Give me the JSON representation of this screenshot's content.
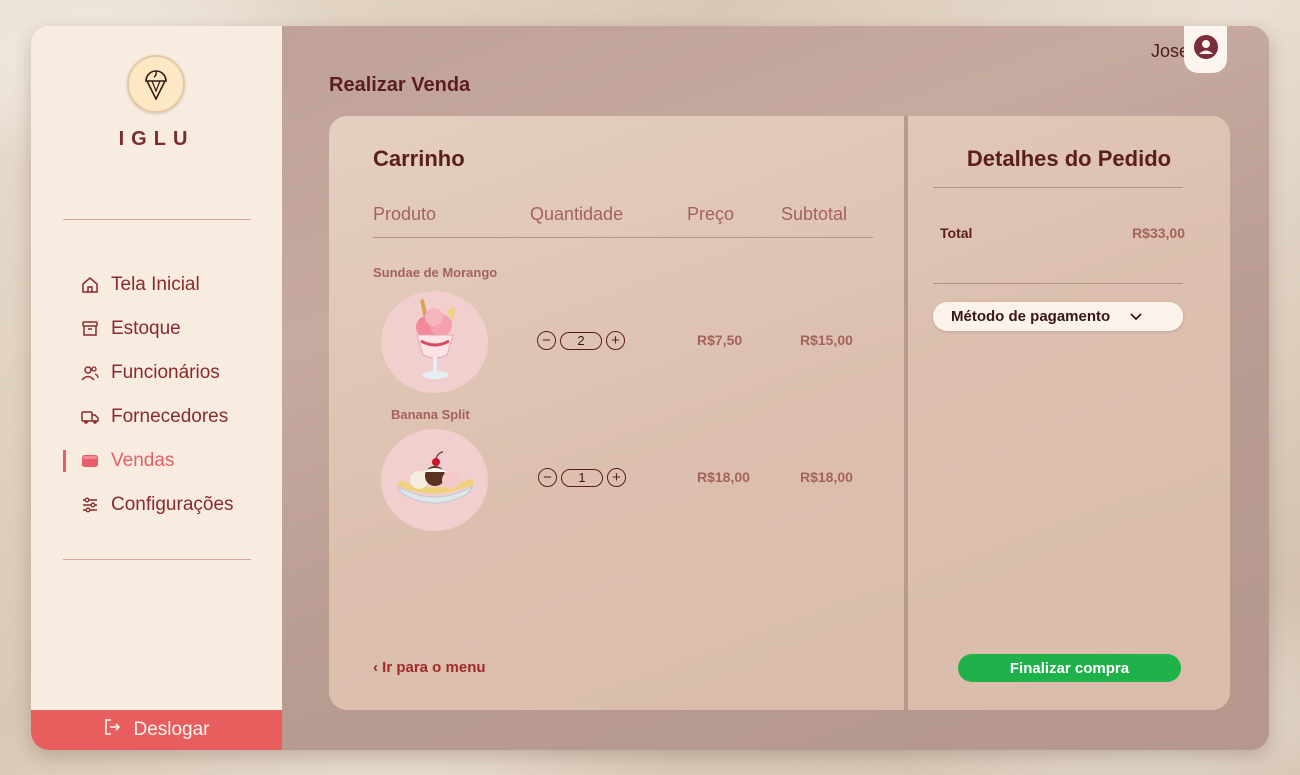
{
  "brand": {
    "name": "IGLU"
  },
  "sidebar": {
    "items": [
      {
        "label": "Tela Inicial",
        "icon": "home-icon"
      },
      {
        "label": "Estoque",
        "icon": "archive-box-icon"
      },
      {
        "label": "Funcionários",
        "icon": "users-icon"
      },
      {
        "label": "Fornecedores",
        "icon": "truck-icon"
      },
      {
        "label": "Vendas",
        "icon": "wallet-icon",
        "active": true
      },
      {
        "label": "Configurações",
        "icon": "sliders-icon"
      }
    ],
    "logout_label": "Deslogar"
  },
  "header": {
    "user_name": "Jose"
  },
  "page": {
    "title": "Realizar Venda"
  },
  "cart": {
    "title": "Carrinho",
    "columns": [
      "Produto",
      "Quantidade",
      "Preço",
      "Subtotal"
    ],
    "items": [
      {
        "name": "Sundae de Morango",
        "quantity": "2",
        "price": "R$7,50",
        "subtotal": "R$15,00"
      },
      {
        "name": "Banana Split",
        "quantity": "1",
        "price": "R$18,00",
        "subtotal": "R$18,00"
      }
    ],
    "back_link": "‹ Ir para o menu"
  },
  "details": {
    "title": "Detalhes do Pedido",
    "total_label": "Total",
    "total_value": "R$33,00",
    "payment_label": "Método de pagamento",
    "finish_label": "Finalizar compra"
  },
  "colors": {
    "accent": "#e85d6a",
    "brand_dark": "#5a1e1e",
    "success": "#1fb24a"
  }
}
